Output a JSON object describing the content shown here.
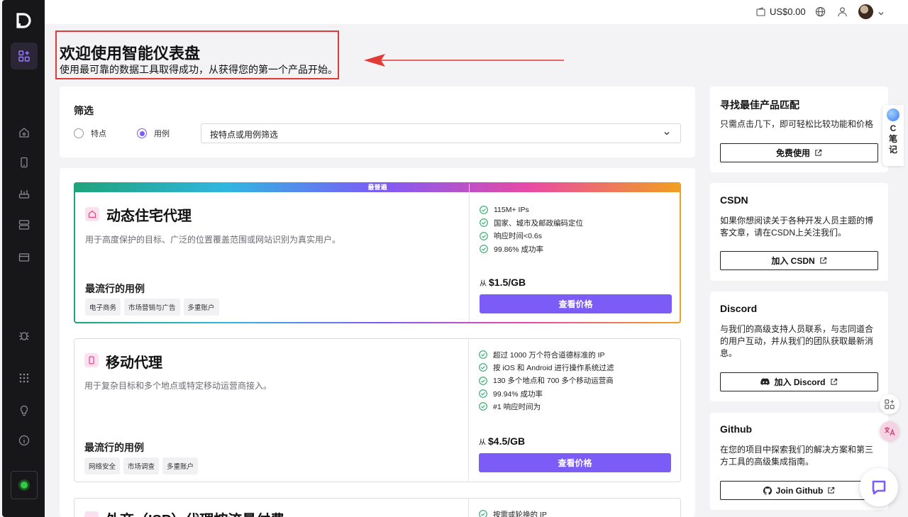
{
  "topbar": {
    "balance": "US$0.00"
  },
  "header": {
    "title": "欢迎使用智能仪表盘",
    "subtitle": "使用最可靠的数据工具取得成功，从获得您的第一个产品开始。"
  },
  "filter": {
    "title": "筛选",
    "options": [
      "特点",
      "用例"
    ],
    "selected": "用例",
    "select_value": "按特点或用例筛选"
  },
  "products": [
    {
      "banner": "最普遍",
      "title": "动态住宅代理",
      "description": "用于高度保护的目标、广泛的位置覆盖范围或网站识别为真实用户。",
      "popular_label": "最流行的用例",
      "tags": [
        "电子商务",
        "市场营销与广告",
        "多重账户"
      ],
      "features": [
        "115M+ IPs",
        "国家、城市及邮政编码定位",
        "响应时间<0.6s",
        "99.86% 成功率"
      ],
      "price_prefix": "从",
      "price": "$1.5/GB",
      "button": "查看价格"
    },
    {
      "title": "移动代理",
      "description": "用于复杂目标和多个地点或特定移动运营商接入。",
      "popular_label": "最流行的用例",
      "tags": [
        "网络安全",
        "市场调查",
        "多重账户"
      ],
      "features": [
        "超过 1000 万个符合道德标准的 IP",
        "按 iOS 和 Android 进行操作系统过滤",
        "130 多个地点和 700 多个移动运营商",
        "99.94% 成功率",
        "#1 响应时间为"
      ],
      "price_prefix": "从",
      "price": "$4.5/GB",
      "button": "查看价格"
    },
    {
      "title": "外商（ISP）代理按流量付费",
      "features": [
        "按需或轮换的 IP"
      ]
    }
  ],
  "side_panels": [
    {
      "title": "寻找最佳产品匹配",
      "text": "只需点击几下，即可轻松比较功能和价格",
      "button": "免费使用"
    },
    {
      "title": "CSDN",
      "text": "如果你想阅读关于各种开发人员主题的博客文章，请在CSDN上关注我们。",
      "button": "加入 CSDN"
    },
    {
      "title": "Discord",
      "text": "与我们的高级支持人员联系，与志同道合的用户互动，并从我们的团队获取最新消息。",
      "button": "加入 Discord"
    },
    {
      "title": "Github",
      "text": "在您的项目中探索我们的解决方案和第三方工具的高级集成指南。",
      "button": "Join Github"
    }
  ],
  "note_widget": {
    "label_1": "C",
    "label_2": "笔",
    "label_3": "记"
  },
  "colors": {
    "accent": "#7c5cf7",
    "sidebar": "#17171a",
    "annotation": "#e53935",
    "check": "#2ea86a"
  }
}
